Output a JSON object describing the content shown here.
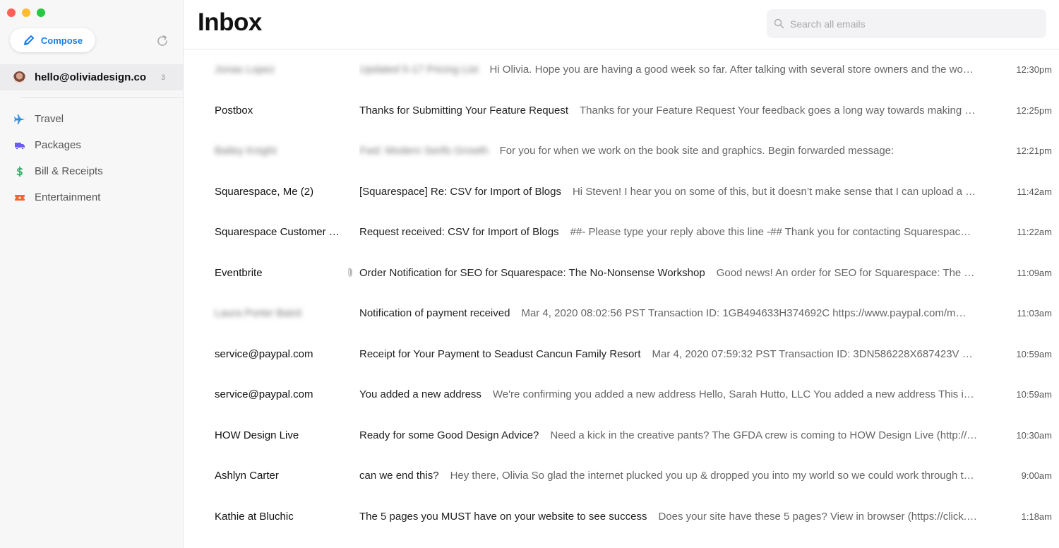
{
  "window": {
    "controls": [
      "close",
      "minimize",
      "zoom"
    ]
  },
  "sidebar": {
    "compose_label": "Compose",
    "account": {
      "email": "hello@oliviadesign.co",
      "count": "3"
    },
    "items": [
      {
        "label": "Travel",
        "icon": "airplane-icon",
        "color": "#2b8ee8"
      },
      {
        "label": "Packages",
        "icon": "truck-icon",
        "color": "#6a5cf0"
      },
      {
        "label": "Bill & Receipts",
        "icon": "dollar-icon",
        "color": "#2fb36a"
      },
      {
        "label": "Entertainment",
        "icon": "ticket-icon",
        "color": "#f2662f"
      }
    ]
  },
  "header": {
    "title": "Inbox",
    "search_placeholder": "Search all emails"
  },
  "emails": [
    {
      "sender": "Jonas Lopez",
      "subject": "Updated 5-17 Pricing List",
      "preview": "Hi Olivia. Hope you are having a good week so far. After talking with several store owners and the wo…",
      "time": "12:30pm",
      "blurred": true
    },
    {
      "sender": "Postbox",
      "subject": "Thanks for Submitting Your Feature Request",
      "preview": "Thanks for your Feature Request Your feedback goes a long way towards making …",
      "time": "12:25pm"
    },
    {
      "sender": "Bailey Knight",
      "subject": "Fwd: Modern Serifs Growth",
      "preview": "For you for when we work on the book site and graphics. Begin forwarded message:",
      "time": "12:21pm",
      "blurred": true
    },
    {
      "sender": "Squarespace, Me (2)",
      "subject": "[Squarespace] Re: CSV for Import of Blogs",
      "preview": "Hi Steven! I hear you on some of this, but it doesn’t make sense that I can upload a …",
      "time": "11:42am"
    },
    {
      "sender": "Squarespace Customer …",
      "subject": "Request received: CSV for Import of Blogs",
      "preview": "##- Please type your reply above this line -## Thank you for contacting Squarespac…",
      "time": "11:22am"
    },
    {
      "sender": "Eventbrite",
      "subject": "Order Notification for SEO for Squarespace: The No-Nonsense Workshop",
      "preview": "Good news! An order for SEO for Squarespace: The …",
      "time": "11:09am",
      "attachment": true
    },
    {
      "sender": "Laura Porter Baird",
      "subject": "Notification of payment received",
      "preview": "Mar 4, 2020 08:02:56 PST Transaction ID: 1GB494633H374692C https://www.paypal.com/m…",
      "time": "11:03am",
      "blurred": true
    },
    {
      "sender": "service@paypal.com",
      "subject": "Receipt for Your Payment to Seadust Cancun Family Resort",
      "preview": "Mar 4, 2020 07:59:32 PST Transaction ID: 3DN586228X687423V …",
      "time": "10:59am"
    },
    {
      "sender": "service@paypal.com",
      "subject": "You added a new address",
      "preview": "We're confirming you added a new address Hello, Sarah Hutto, LLC You added a new address This i…",
      "time": "10:59am"
    },
    {
      "sender": "HOW Design Live",
      "subject": "Ready for some Good Design Advice?",
      "preview": "Need a kick in the creative pants? The GFDA crew is coming to HOW Design Live (http://…",
      "time": "10:30am"
    },
    {
      "sender": "Ashlyn Carter",
      "subject": "can we end this?",
      "preview": "Hey there, Olivia So glad the internet plucked you up & dropped you into my world so we could work through t…",
      "time": "9:00am"
    },
    {
      "sender": "Kathie at Bluchic",
      "subject": "The 5 pages you MUST have on your website to see success",
      "preview": "Does your site have these 5 pages? View in browser (https://click.…",
      "time": "1:18am"
    }
  ]
}
